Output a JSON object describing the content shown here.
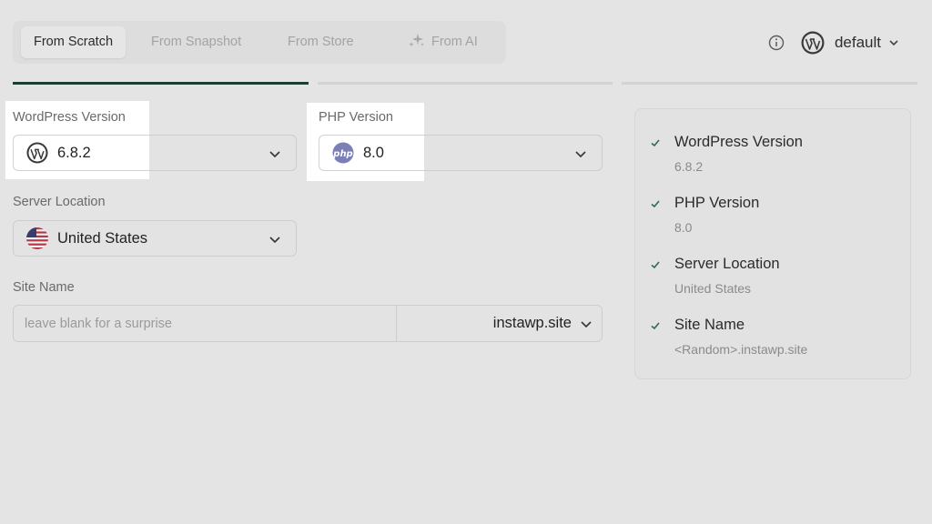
{
  "tabs": [
    {
      "label": "From Scratch",
      "active": true
    },
    {
      "label": "From Snapshot",
      "active": false
    },
    {
      "label": "From Store",
      "active": false
    },
    {
      "label": "From AI",
      "active": false,
      "icon": "sparkle-icon"
    }
  ],
  "profile": {
    "name": "default",
    "icon": "wordpress-icon"
  },
  "form": {
    "wp_version": {
      "label": "WordPress Version",
      "value": "6.8.2",
      "icon": "wordpress-icon"
    },
    "php_version": {
      "label": "PHP Version",
      "value": "8.0",
      "icon": "php-icon"
    },
    "server_location": {
      "label": "Server Location",
      "value": "United States",
      "icon": "us-flag-icon"
    },
    "site_name": {
      "label": "Site Name",
      "placeholder": "leave blank for a surprise",
      "value": "",
      "domain": "instawp.site"
    }
  },
  "summary": [
    {
      "title": "WordPress Version",
      "value": "6.8.2"
    },
    {
      "title": "PHP Version",
      "value": "8.0"
    },
    {
      "title": "Server Location",
      "value": "United States"
    },
    {
      "title": "Site Name",
      "value": "<Random>.instawp.site"
    }
  ],
  "colors": {
    "accent": "#1e3d31",
    "background": "#e4e4e4",
    "highlight": "#ffffff",
    "php": "#7b7fb5"
  }
}
